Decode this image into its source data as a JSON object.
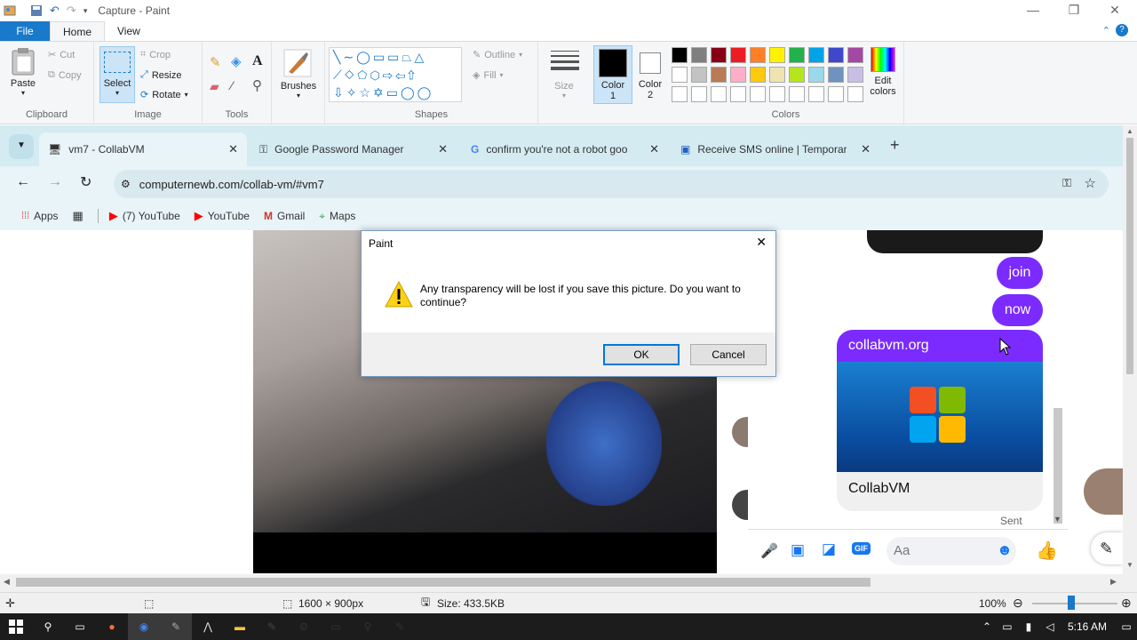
{
  "window": {
    "title": "Capture - Paint"
  },
  "ribbon": {
    "tabs": [
      "File",
      "Home",
      "View"
    ],
    "clipboard": {
      "paste": "Paste",
      "cut": "Cut",
      "copy": "Copy",
      "label": "Clipboard"
    },
    "image": {
      "select": "Select",
      "crop": "Crop",
      "resize": "Resize",
      "rotate": "Rotate",
      "label": "Image"
    },
    "tools": {
      "label": "Tools"
    },
    "brushes": {
      "label": "Brushes"
    },
    "shapes": {
      "outline": "Outline",
      "fill": "Fill",
      "label": "Shapes"
    },
    "size": {
      "label": "Size"
    },
    "color1": {
      "label": "Color",
      "num": "1"
    },
    "color2": {
      "label": "Color",
      "num": "2"
    },
    "colors": {
      "label": "Colors",
      "edit_line1": "Edit",
      "edit_line2": "colors"
    },
    "palette_row1": [
      "#000000",
      "#7f7f7f",
      "#880015",
      "#ed1c24",
      "#ff7f27",
      "#fff200",
      "#22b14c",
      "#00a2e8",
      "#3f48cc",
      "#a349a4"
    ],
    "palette_row2": [
      "#ffffff",
      "#c3c3c3",
      "#b97a57",
      "#ffaec9",
      "#ffc90e",
      "#efe4b0",
      "#b5e61d",
      "#99d9ea",
      "#7092be",
      "#c8bfe7"
    ]
  },
  "browser": {
    "tabs": [
      {
        "title": "vm7 - CollabVM"
      },
      {
        "title": "Google Password Manager"
      },
      {
        "title": "confirm you're not a robot goo"
      },
      {
        "title": "Receive SMS online | Temporar"
      }
    ],
    "url": "computernewb.com/collab-vm/#vm7",
    "bookmarks": [
      "Apps",
      "(7) YouTube",
      "YouTube",
      "Gmail",
      "Maps"
    ]
  },
  "chat": {
    "bubbles": [
      "join",
      "now"
    ],
    "link_card": {
      "domain": "collabvm.org",
      "title": "CollabVM"
    },
    "status": "Sent",
    "input_placeholder": "Aa",
    "gif_label": "GIF"
  },
  "dialog": {
    "title": "Paint",
    "message": "Any transparency will be lost if you save this picture. Do you want to continue?",
    "ok": "OK",
    "cancel": "Cancel"
  },
  "statusbar": {
    "dimensions": "1600 × 900px",
    "size": "Size: 433.5KB",
    "zoom": "100%"
  },
  "taskbar": {
    "time": "5:16 AM"
  }
}
